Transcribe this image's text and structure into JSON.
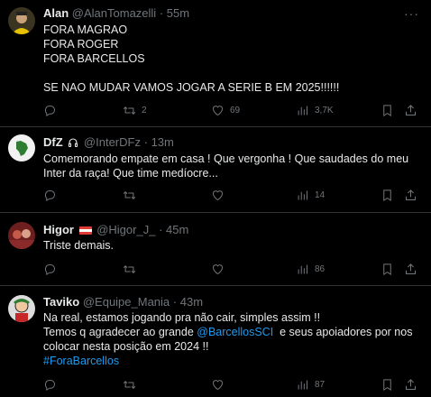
{
  "tweets": [
    {
      "name": "Alan",
      "handle": "@AlanTomazelli",
      "dot": "·",
      "time": "55m",
      "lines": [
        "FORA MAGRAO",
        "FORA ROGER",
        "FORA BARCELLOS",
        "",
        "SE NAO MUDAR VAMOS JOGAR A SERIE B EM 2025!!!!!!"
      ],
      "retweets": "2",
      "likes": "69",
      "views": "3,7K"
    },
    {
      "name": "DfZ",
      "handle": "@InterDFz",
      "dot": "·",
      "time": "13m",
      "lines": [
        "Comemorando empate em casa ! Que vergonha ! Que saudades do meu",
        "Inter da raça! Que time medíocre..."
      ],
      "retweets": "",
      "likes": "",
      "views": "14"
    },
    {
      "name": "Higor",
      "handle": "@Higor_J_",
      "dot": "·",
      "time": "45m",
      "lines": [
        "Triste demais."
      ],
      "retweets": "",
      "likes": "",
      "views": "86"
    },
    {
      "name": "Taviko",
      "handle": "@Equipe_Mania",
      "dot": "·",
      "time": "43m",
      "line1": "Na real, estamos jogando pra não cair, simples assim !!",
      "line2_pre": "Temos q agradecer ao grande ",
      "line2_mention": "@BarcellosSCI",
      "line2_post": "  e seus apoiadores por nos",
      "line3": "colocar nesta posição em 2024 !!",
      "hashtag": "#ForaBarcellos",
      "retweets": "",
      "likes": "",
      "views": "87"
    }
  ],
  "icons": {
    "reply": "reply-icon",
    "retweet": "retweet-icon",
    "like": "heart-icon",
    "views": "views-icon",
    "bookmark": "bookmark-icon",
    "share": "share-icon",
    "more": "more-icon"
  },
  "colors": {
    "background": "#000000",
    "text": "#e7e9ea",
    "muted": "#71767b",
    "link": "#1d9bf0",
    "divider": "#2f3336"
  }
}
